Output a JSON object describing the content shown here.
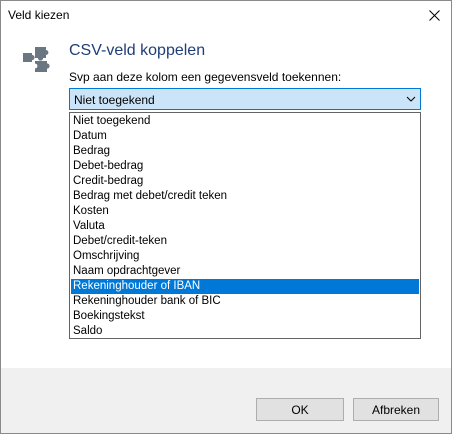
{
  "window": {
    "title": "Veld kiezen"
  },
  "dialog": {
    "heading": "CSV-veld koppelen",
    "prompt": "Svp aan deze kolom een gegevensveld toekennen:",
    "selected_value": "Niet toegekend"
  },
  "dropdown": {
    "items": [
      "Niet toegekend",
      "Datum",
      "Bedrag",
      "Debet-bedrag",
      "Credit-bedrag",
      "Bedrag met debet/credit teken",
      "Kosten",
      "Valuta",
      "Debet/credit-teken",
      "Omschrijving",
      "Naam opdrachtgever",
      "Rekeninghouder of IBAN",
      "Rekeninghouder bank of BIC",
      "Boekingstekst",
      "Saldo"
    ],
    "highlighted_index": 11
  },
  "buttons": {
    "ok": "OK",
    "cancel": "Afbreken"
  },
  "icons": {
    "dialog": "puzzle-icon",
    "close": "close-icon",
    "combo": "chevron-down-icon"
  },
  "colors": {
    "heading": "#1f3e78",
    "accent": "#0078d7",
    "combo_bg": "#cce4f7",
    "icon": "#6b7683"
  }
}
